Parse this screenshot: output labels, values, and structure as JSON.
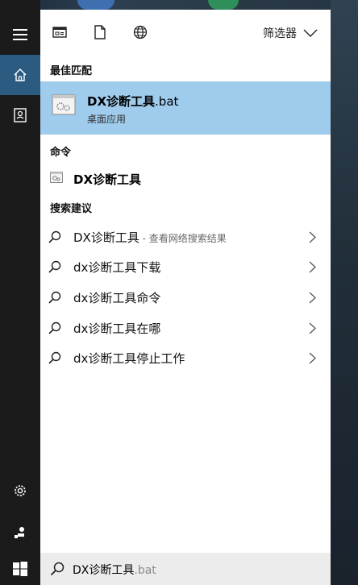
{
  "filter": {
    "label": "筛选器"
  },
  "sections": {
    "best_match": "最佳匹配",
    "commands": "命令",
    "suggestions": "搜索建议"
  },
  "best_match": {
    "name": "DX诊断工具",
    "ext": ".bat",
    "subtitle": "桌面应用"
  },
  "command": {
    "label": "DX诊断工具"
  },
  "suggestions": [
    {
      "text": "DX诊断工具",
      "hint": " - 查看网络搜索结果"
    },
    {
      "text": "dx诊断工具下载"
    },
    {
      "text": "dx诊断工具命令"
    },
    {
      "text": "dx诊断工具在哪"
    },
    {
      "text": "dx诊断工具停止工作"
    }
  ],
  "search": {
    "query": "DX诊断工具",
    "completion": ".bat"
  },
  "colors": {
    "accent": "#2b5b80",
    "selection": "#9fcbec",
    "rail": "#1b1b1b"
  }
}
